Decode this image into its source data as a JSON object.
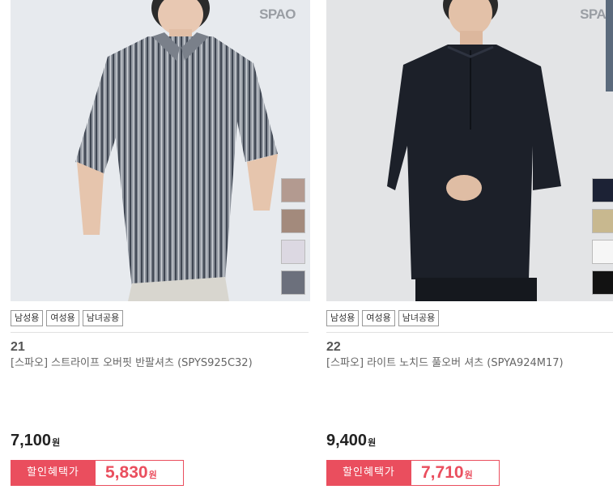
{
  "products": [
    {
      "brand": "SPAO",
      "tags": [
        "남성용",
        "여성용",
        "남녀공용"
      ],
      "number": "21",
      "name": "[스파오] 스트라이프 오버핏 반팔셔츠 (SPYS925C32)",
      "price": "7,100",
      "price_unit": "원",
      "sale_label": "할인혜택가",
      "sale_price": "5,830",
      "sale_unit": "원",
      "swatches": [
        "#b39a90",
        "#a38a7c",
        "#dcd8e2",
        "#6c707c"
      ]
    },
    {
      "brand": "SPAO",
      "tags": [
        "남성용",
        "여성용",
        "남녀공용"
      ],
      "number": "22",
      "name": "[스파오] 라이트 노치드 풀오버 셔츠 (SPYA924M17)",
      "price": "9,400",
      "price_unit": "원",
      "sale_label": "할인혜택가",
      "sale_price": "7,710",
      "sale_unit": "원",
      "swatches": [
        "#1c2235",
        "#c8b88f",
        "#f6f6f6",
        "#121212"
      ]
    }
  ]
}
